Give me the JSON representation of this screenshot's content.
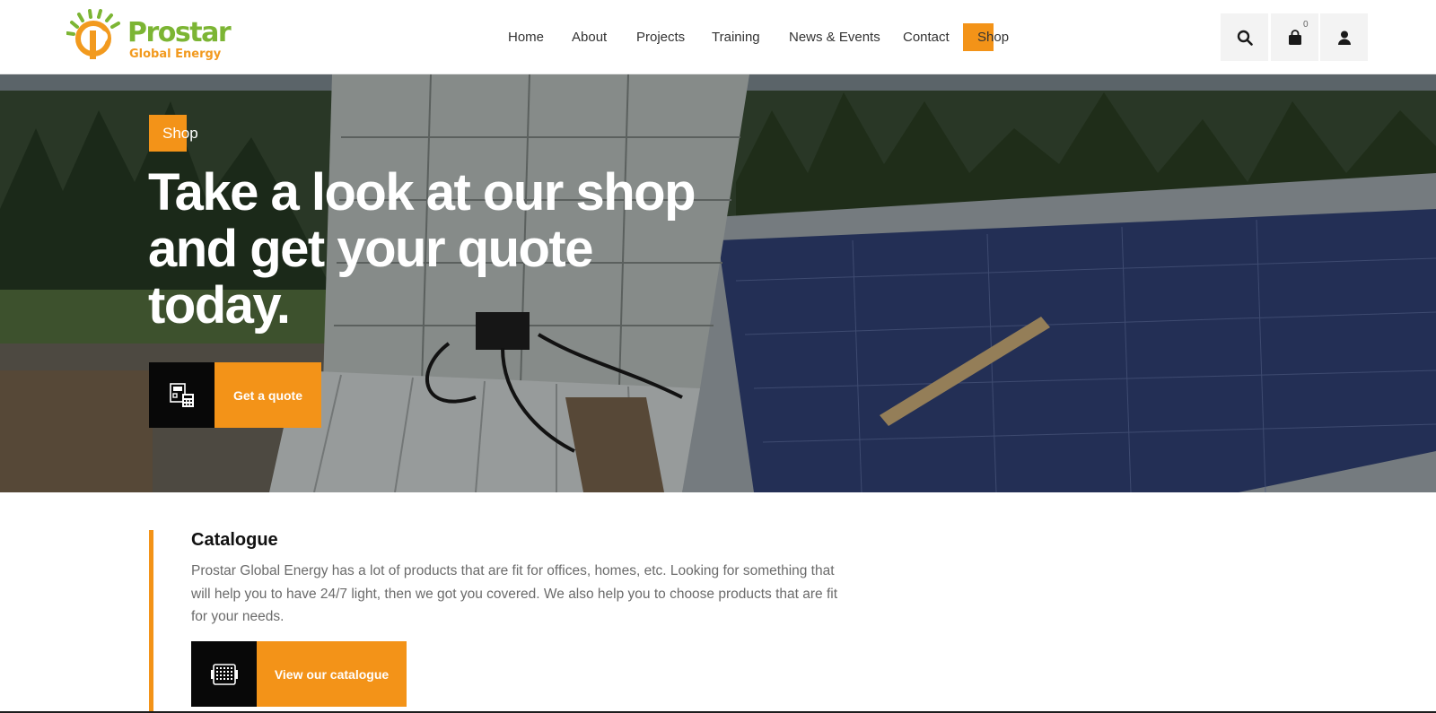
{
  "brand": {
    "name": "Prostar",
    "subtitle": "Global Energy",
    "green": "#7cb534",
    "orange": "#f29a1e"
  },
  "nav": {
    "items": [
      {
        "label": "Home"
      },
      {
        "label": "About"
      },
      {
        "label": "Projects"
      },
      {
        "label": "Training"
      },
      {
        "label": "News & Events"
      },
      {
        "label": "Contact"
      },
      {
        "label": "Shop",
        "active": true
      }
    ]
  },
  "header_actions": {
    "search_icon": "search-icon",
    "cart_icon": "shopping-bag-icon",
    "cart_count": "0",
    "account_icon": "user-icon"
  },
  "hero": {
    "badge": "Shop",
    "title_line1": "Take a look at our shop",
    "title_line2": "and get your quote",
    "title_line3": "today.",
    "cta_label": "Get a quote",
    "cta_icon": "calculator-quote-icon"
  },
  "catalogue": {
    "title": "Catalogue",
    "text": "Prostar Global Energy has a lot of products that are fit for offices, homes, etc. Looking for something that will help you to have 24/7 light, then we got you covered. We also help you to choose products that are fit for your needs.",
    "button_label": "View our catalogue",
    "button_icon": "solar-panel-icon"
  },
  "colors": {
    "accent": "#f39318",
    "dark": "#080808"
  }
}
